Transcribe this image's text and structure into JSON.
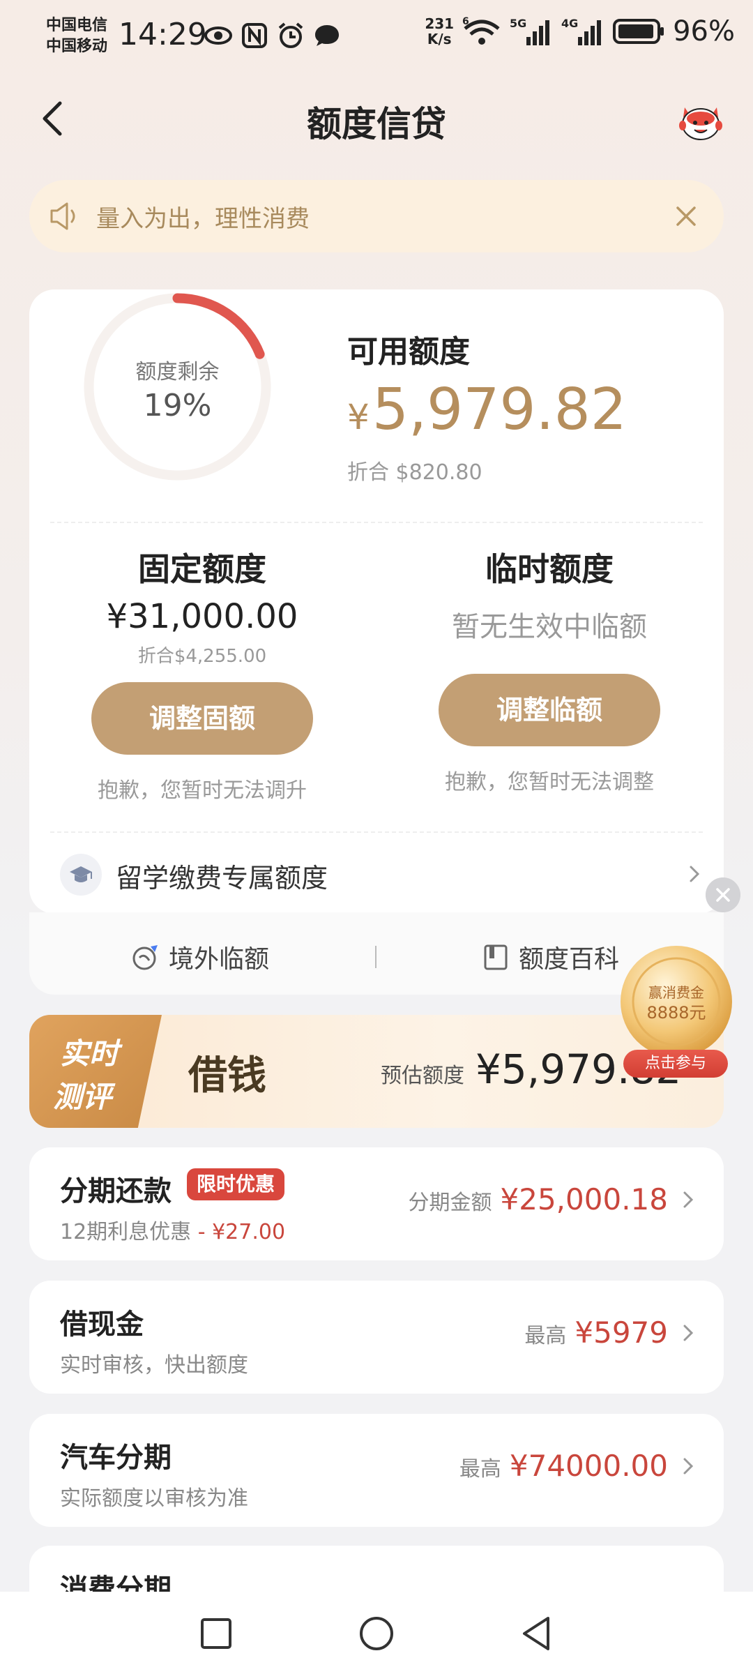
{
  "status": {
    "carrier1": "中国电信",
    "carrier2": "中国移动",
    "time": "14:29",
    "net_speed_value": "231",
    "net_speed_unit": "K/s",
    "wifi_label": "6",
    "sig1_label": "5G",
    "sig2_label": "4G",
    "battery": "96%"
  },
  "header": {
    "title": "额度信贷"
  },
  "notice": {
    "text": "量入为出，理性消费"
  },
  "credit": {
    "gauge_label": "额度剩余",
    "gauge_value": "19%",
    "gauge_fraction": 0.19,
    "available_title": "可用额度",
    "available_currency": "¥",
    "available_amount": "5,979.82",
    "available_equiv": "折合  $820.80",
    "fixed": {
      "title": "固定额度",
      "amount": "¥31,000.00",
      "equiv": "折合$4,255.00",
      "button": "调整固额",
      "note": "抱歉，您暂时无法调升"
    },
    "temp": {
      "title": "临时额度",
      "status": "暂无生效中临额",
      "button": "调整临额",
      "note": "抱歉，您暂时无法调整"
    },
    "study_label": "留学缴费专属额度",
    "links": {
      "overseas": "境外临额",
      "wiki": "额度百科"
    }
  },
  "loan": {
    "badge_line1": "实时",
    "badge_line2": "测评",
    "title": "借钱",
    "est_label": "预估额度",
    "est_amount": "¥5,979.82",
    "coin_text1": "赢消费金",
    "coin_text2": "8888元",
    "coin_button": "点击参与"
  },
  "products": [
    {
      "title": "分期还款",
      "promo": "限时优惠",
      "sub": "12期利息优惠",
      "sub_extra": "- ¥27.00",
      "right_label": "分期金额",
      "right_value": "¥25,000.18"
    },
    {
      "title": "借现金",
      "sub": "实时审核，快出额度",
      "right_label": "最高",
      "right_value": "¥5979"
    },
    {
      "title": "汽车分期",
      "sub": "实际额度以审核为准",
      "right_label": "最高",
      "right_value": "¥74000.00"
    },
    {
      "title": "消费分期"
    }
  ],
  "colors": {
    "accent_gold": "#b58e5d",
    "button_gold": "#c39f74",
    "price_red": "#c9463c",
    "gauge_red": "#e0574f"
  }
}
